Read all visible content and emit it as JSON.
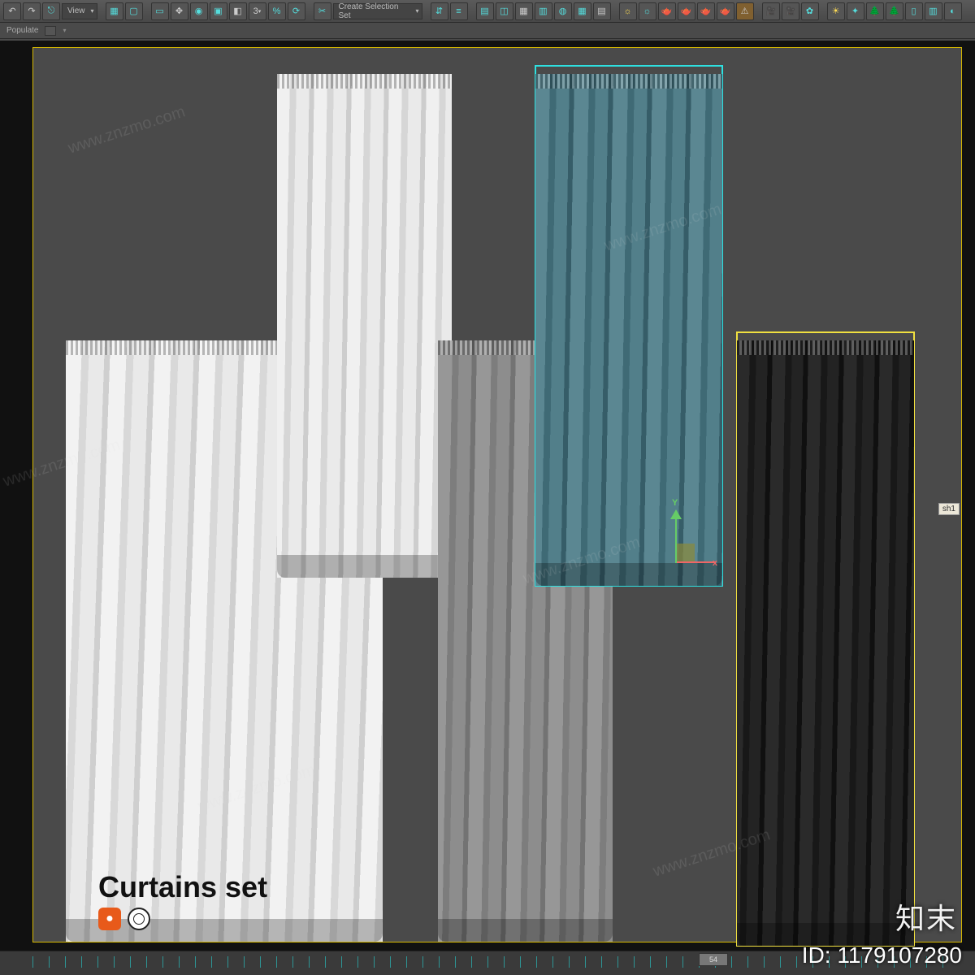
{
  "toolbar": {
    "view_label": "View",
    "selection_set_label": "Create Selection Set",
    "three_label": "3",
    "percent_label": "%"
  },
  "toolbar2": {
    "populate_label": "Populate"
  },
  "gizmo": {
    "y": "Y",
    "x": "x"
  },
  "scene": {
    "title": "Curtains set",
    "corona_badge": "●",
    "object_tag": "sh1"
  },
  "timeline": {
    "thumb": "54"
  },
  "overlay": {
    "brand": "知末",
    "id_label": "ID: 1179107280",
    "watermark": "www.znzmo.com"
  }
}
